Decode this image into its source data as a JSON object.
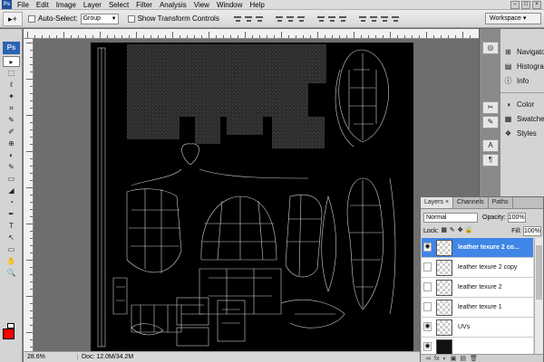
{
  "app": {
    "icon_label": "Ps"
  },
  "menubar": {
    "items": [
      "File",
      "Edit",
      "Image",
      "Layer",
      "Select",
      "Filter",
      "Analysis",
      "View",
      "Window",
      "Help"
    ],
    "window_controls": [
      "–",
      "□",
      "×"
    ]
  },
  "options_bar": {
    "tool_glyph": "▸+",
    "auto_select_label": "Auto-Select:",
    "auto_select_value": "Group",
    "show_transform_label": "Show Transform Controls",
    "workspace_label": "Workspace ▾"
  },
  "tools": {
    "logo": "Ps",
    "glyphs": [
      "▸",
      "⬚",
      "ℓ",
      "✦",
      "⌗",
      "✎",
      "✐",
      "⊕",
      "◐",
      "✎",
      "▭",
      "◢",
      "◔",
      "✒",
      "T",
      "↖",
      "▭",
      "✋",
      "🔍"
    ],
    "fg_color": "#ff0000",
    "bg_color": "#ffffff"
  },
  "status": {
    "zoom": "28.6%",
    "doc": "Doc: 12.0M/34.2M"
  },
  "dock": {
    "panels": [
      {
        "label": "Navigator",
        "icon": "⊞"
      },
      {
        "label": "Histogram",
        "icon": "▤"
      },
      {
        "label": "Info",
        "icon": "ⓘ"
      },
      {
        "label": "Color",
        "icon": "◑"
      },
      {
        "label": "Swatches",
        "icon": "▦"
      },
      {
        "label": "Styles",
        "icon": "❖"
      }
    ],
    "buttons": [
      "◎",
      "✂",
      "✎",
      "A",
      "¶"
    ]
  },
  "layers_panel": {
    "tabs": [
      "Layers ×",
      "Channels",
      "Paths"
    ],
    "blend_mode": "Normal",
    "opacity_label": "Opacity:",
    "opacity_value": "100%",
    "lock_label": "Lock:",
    "fill_label": "Fill:",
    "fill_value": "100%",
    "layers": [
      {
        "name": "leather texure 2 co...",
        "visible": true,
        "selected": true
      },
      {
        "name": "leather texure 2 copy",
        "visible": false,
        "selected": false
      },
      {
        "name": "leather texure 2",
        "visible": false,
        "selected": false
      },
      {
        "name": "leather texure 1",
        "visible": false,
        "selected": false
      },
      {
        "name": "UVs",
        "visible": true,
        "selected": false
      },
      {
        "name": "",
        "visible": true,
        "selected": false
      }
    ],
    "bottom_icons": [
      "∞",
      "fx",
      "◐",
      "▣",
      "▤",
      "🗑"
    ]
  },
  "colors": {
    "selection": "#3f86e6",
    "canvas": "#000000",
    "uv_lines": "#d0d0d0"
  }
}
